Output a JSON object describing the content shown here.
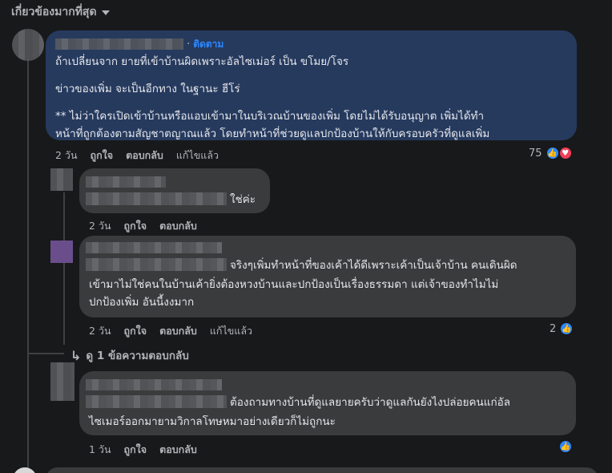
{
  "sort": {
    "label": "เกี่ยวข้องมากที่สุด"
  },
  "comments": [
    {
      "follow": "ติดตาม",
      "lines": [
        "ถ้าเปลี่ยนจาก ยายที่เข้าบ้านผิดเพราะอัลไซเม่อร์ เป็น ขโมย/โจร",
        "ข่าวของเพิ่ม จะเป็นอีกทาง ในฐานะ ฮีโร่",
        "** ไม่ว่าใครเปิดเข้าบ้านหรือแอบเข้ามาในบริเวณบ้านของเพิ่ม โดยไม่ได้รับอนุญาต เพิ่มได้ทำ",
        "หน้าที่ถูกต้องตามสัญชาตญาณแล้ว โดยทำหน้าที่ช่วยดูแลปกป้องบ้านให้กับครอบครัวที่ดูแลเพิ่ม"
      ],
      "time": "2 วัน",
      "like": "ถูกใจ",
      "reply": "ตอบกลับ",
      "edited": "แก้ไขแล้ว",
      "reaction_count": "75"
    },
    {
      "text": "ใช่ค่ะ",
      "time": "2 วัน",
      "like": "ถูกใจ",
      "reply": "ตอบกลับ"
    },
    {
      "lines": [
        "จริงๆเพิ่มทำหน้าที่ของเค้าได้ดีเพราะเค้าเป็นเจ้าบ้าน คนเดินผิด",
        "เข้ามาไม่ใช่คนในบ้านเค้ายิ่งต้องหวงบ้านและปกป้องเป็นเรื่องธรรมดา แต่เจ้าของทำไมไม่",
        "ปกป้องเพิ่ม อันนี้งงมาก"
      ],
      "time": "2 วัน",
      "like": "ถูกใจ",
      "reply": "ตอบกลับ",
      "edited": "แก้ไขแล้ว",
      "reaction_count": "2"
    },
    {
      "view_replies": "ดู 1 ข้อความตอบกลับ"
    },
    {
      "lines": [
        "ต้องถามทางบ้านที่ดูแลยายครับว่าดูแลกันยังไงปล่อยคนแก่อัล",
        "ไซเมอร์ออกมายามวิกาลโทษหมาอย่างเดียวก็ไม่ถูกนะ"
      ],
      "time": "1 วัน",
      "like": "ถูกใจ",
      "reply": "ตอบกลับ"
    }
  ],
  "colors": {
    "highlight_bubble": "#263a5e",
    "bubble": "#3a3b3c",
    "like": "#2d88ff",
    "love": "#f33e58"
  }
}
